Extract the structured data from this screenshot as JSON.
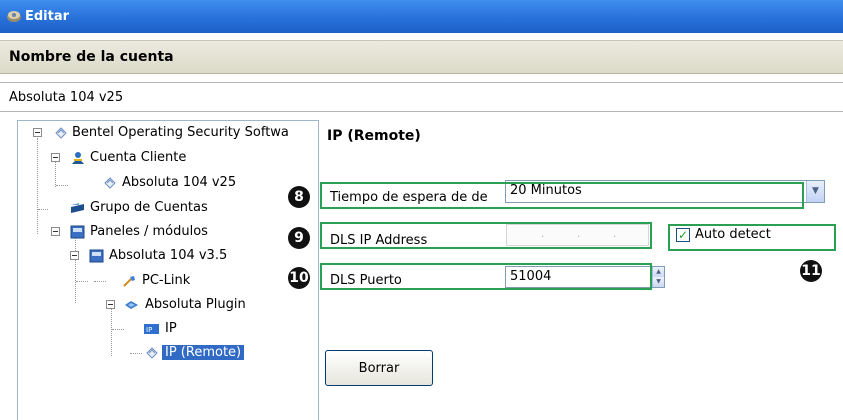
{
  "window": {
    "title": "Editar"
  },
  "section": {
    "title": "Nombre de la cuenta"
  },
  "account": {
    "name": "Absoluta 104 v25"
  },
  "tree": {
    "items": [
      {
        "label": "Bentel Operating Security Softwa",
        "icon": "network-icon"
      },
      {
        "label": "Cuenta Cliente",
        "icon": "user-icon"
      },
      {
        "label": "Absoluta 104 v25",
        "icon": "network-icon"
      },
      {
        "label": "Grupo de Cuentas",
        "icon": "folder-icon"
      },
      {
        "label": "Paneles / módulos",
        "icon": "panel-icon"
      },
      {
        "label": "Absoluta 104 v3.5",
        "icon": "panel-icon"
      },
      {
        "label": "PC-Link",
        "icon": "link-icon"
      },
      {
        "label": "Absoluta Plugin",
        "icon": "plugin-icon"
      },
      {
        "label": "IP",
        "icon": "ip-icon"
      },
      {
        "label": "IP (Remote)",
        "icon": "network-icon",
        "selected": true
      }
    ]
  },
  "form": {
    "heading": "IP (Remote)",
    "timeout": {
      "label": "Tiempo de espera de de",
      "value": "20 Minutos"
    },
    "ip": {
      "label": "DLS IP Address",
      "value": ""
    },
    "auto_detect": {
      "label": "Auto detect",
      "checked": true
    },
    "port": {
      "label": "DLS Puerto",
      "value": "51004"
    },
    "clear_button": "Borrar"
  },
  "markers": [
    "8",
    "9",
    "10",
    "11"
  ],
  "colors": {
    "titlebar": "#2a73dc",
    "highlight": "#2aa152",
    "selection": "#316ac5"
  }
}
